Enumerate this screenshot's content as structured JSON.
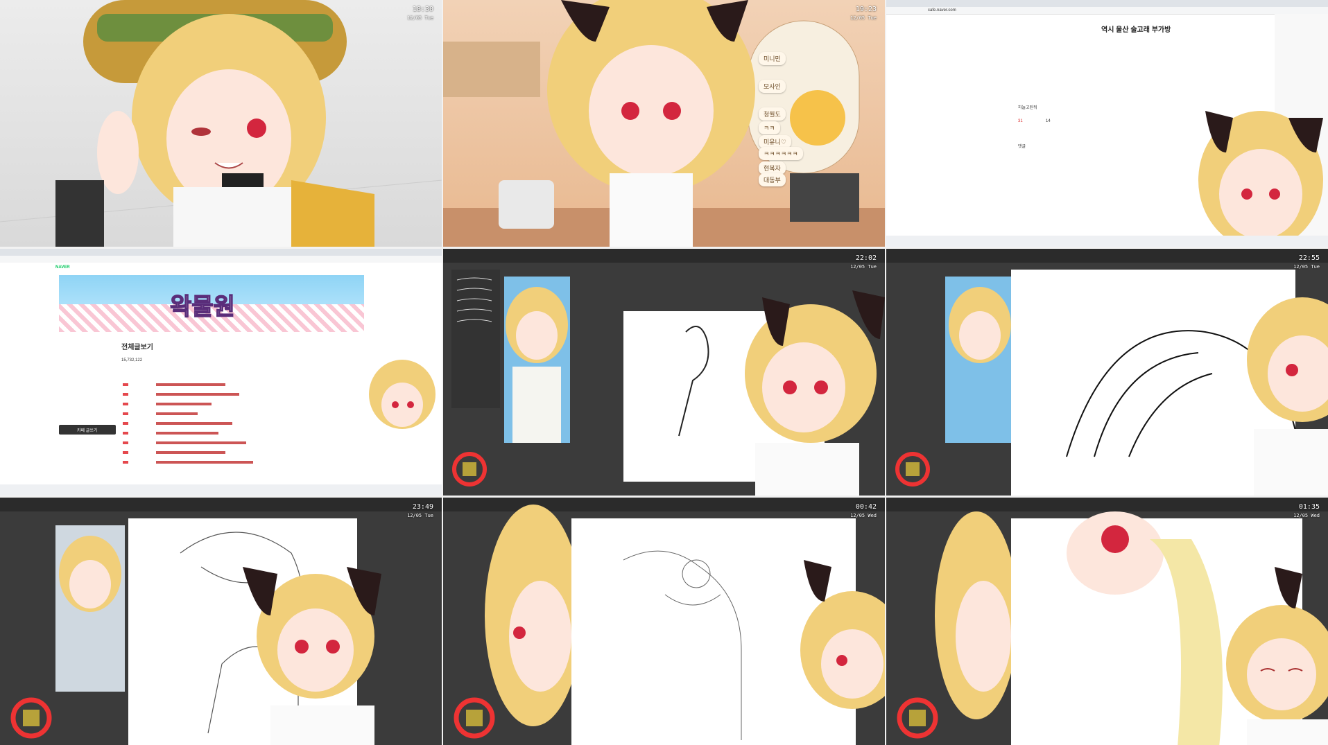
{
  "tiles": [
    {
      "id": "t1",
      "time": "18:30",
      "date": "12/05 Tue"
    },
    {
      "id": "t2",
      "time": "19:23",
      "date": "12/05 Tue",
      "chat": [
        "미니민",
        "모사인",
        "청월도",
        "ㅋㅋ",
        "미유니♡",
        "ㅋㅋㅋㅋㅋㅋ",
        "현복자",
        "대동부"
      ]
    },
    {
      "id": "t3",
      "heading": "역시 울산 술고래 부가방",
      "url": "cafe.naver.com",
      "user": "하늘고된뒤",
      "comment_label": "댓글",
      "likes": "31",
      "comments": "14"
    },
    {
      "id": "t4",
      "banner": "왁물원",
      "section": "전체글보기",
      "count": "15,732,122",
      "brand": "NAVER",
      "write_btn": "카페 글쓰기"
    },
    {
      "id": "t5",
      "time": "22:02",
      "date": "12/05 Tue"
    },
    {
      "id": "t6",
      "time": "22:55",
      "date": "12/05 Tue"
    },
    {
      "id": "t7",
      "time": "23:49",
      "date": "12/05 Tue"
    },
    {
      "id": "t8",
      "time": "00:42",
      "date": "12/05 Wed"
    },
    {
      "id": "t9",
      "time": "01:35",
      "date": "12/05 Wed"
    }
  ],
  "colors": {
    "hair": "#f1cf7a",
    "hair_dark": "#d9a84e",
    "eye": "#d3263e",
    "skin": "#fde6dc",
    "ear": "#2a1a1a",
    "csp_dark": "#3b3b3b"
  }
}
